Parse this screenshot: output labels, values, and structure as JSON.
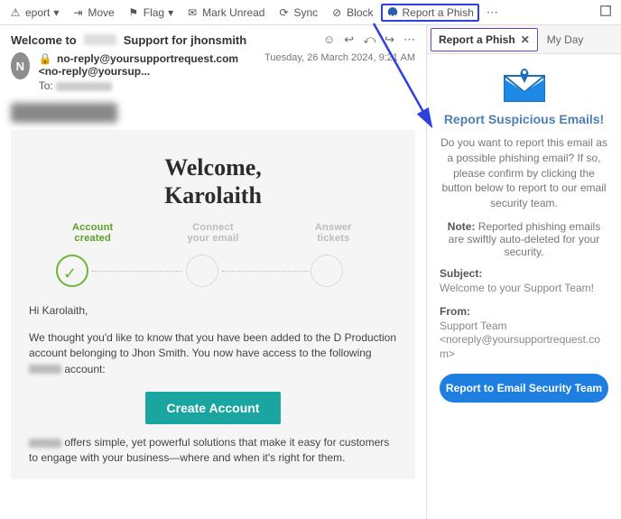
{
  "toolbar": {
    "report": "eport",
    "move": "Move",
    "flag": "Flag",
    "mark_unread": "Mark Unread",
    "sync": "Sync",
    "block": "Block",
    "report_phish": "Report a Phish"
  },
  "message": {
    "subject_prefix": "Welcome to",
    "subject_suffix": "Support for jhonsmith",
    "avatar_initial": "N",
    "sender": "no-reply@yoursupportrequest.com <no-reply@yoursup...",
    "to_label": "To:",
    "date": "Tuesday, 26 March 2024, 9:21 AM"
  },
  "email": {
    "welcome_line1": "Welcome,",
    "welcome_line2": "Karolaith",
    "steps": {
      "s1a": "Account",
      "s1b": "created",
      "s2a": "Connect",
      "s2b": "your email",
      "s3a": "Answer",
      "s3b": "tickets"
    },
    "greeting": "Hi Karolaith,",
    "p1": "We thought you'd like to know that you have been added to the D Production account belonging to Jhon Smith. You now have access to the following",
    "p1_tail": " account:",
    "cta": "Create Account",
    "p2_lead": " offers simple, yet powerful solutions that make it easy for customers to engage with your business—where and when it's right for them."
  },
  "side": {
    "tab_active": "Report a Phish",
    "tab_myday": "My Day",
    "title": "Report Suspicious Emails!",
    "desc": "Do you want to report this email as a possible phishing email?  If so, please confirm by clicking the button below to report to our email security team.",
    "note_label": "Note:",
    "note_text": " Reported phishing emails are swiftly auto-deleted for your security.",
    "subject_label": "Subject:",
    "subject_val": "Welcome to your Support Team!",
    "from_label": "From:",
    "from_val": "Support Team <noreply@yoursupportrequest.com>",
    "button": "Report to Email Security Team"
  }
}
